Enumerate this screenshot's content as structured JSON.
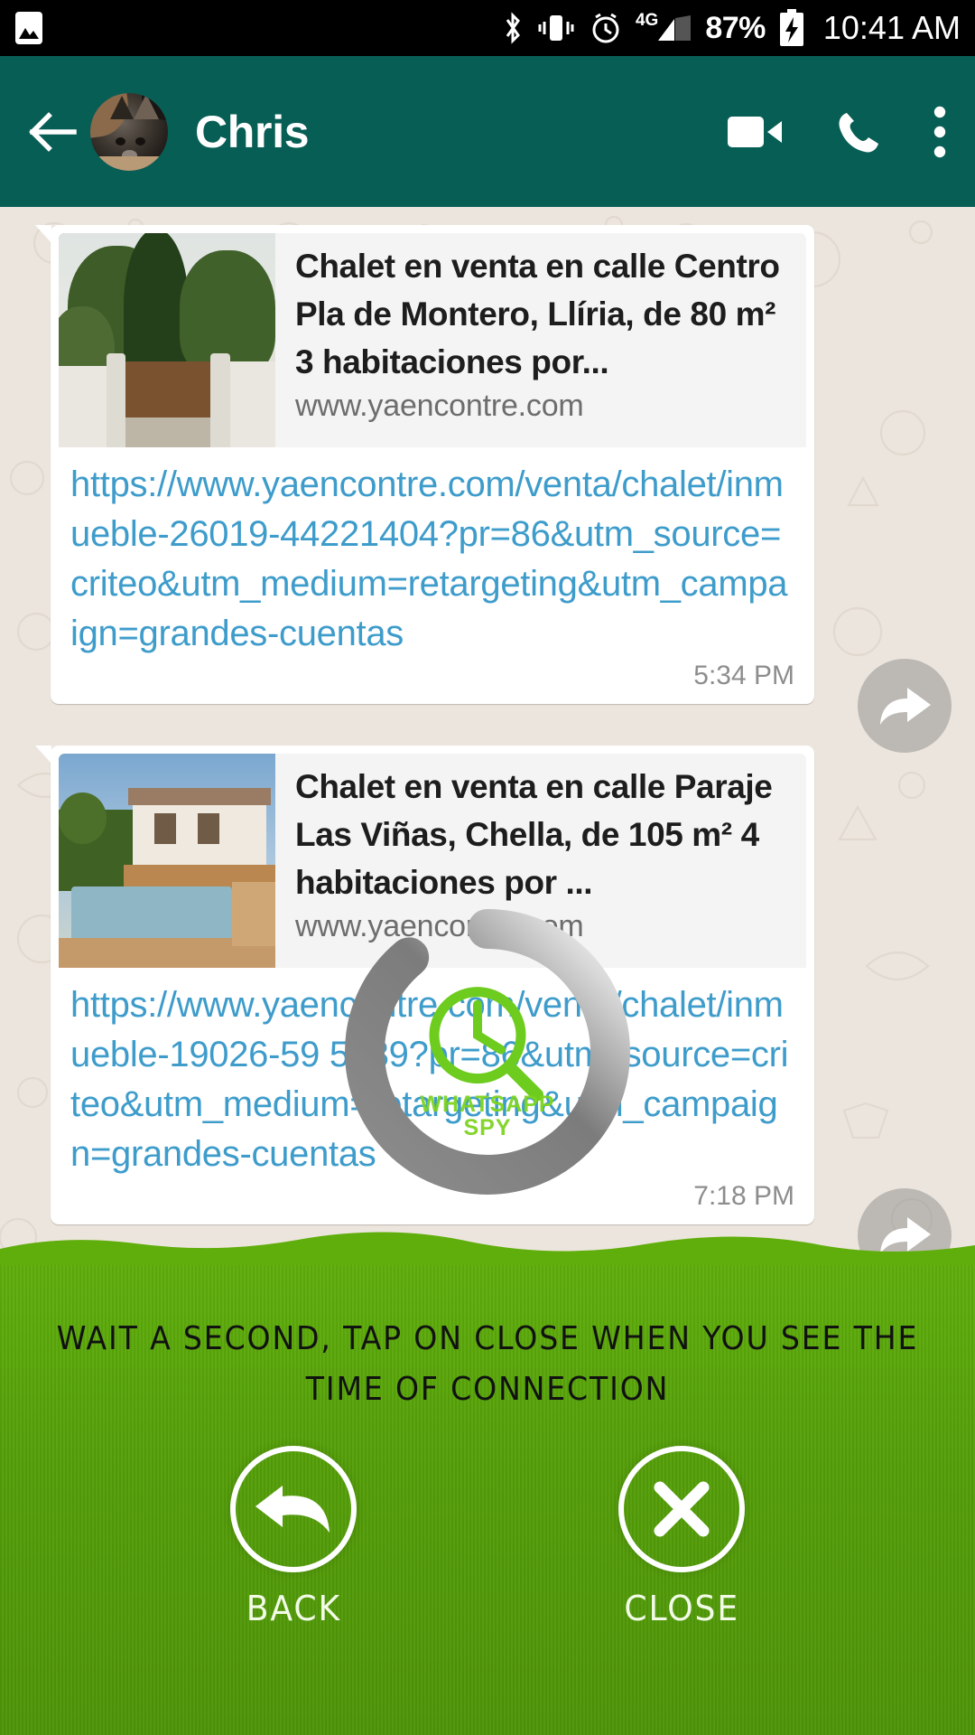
{
  "status_bar": {
    "left_icons": [
      "image-icon"
    ],
    "right_icons": [
      "bluetooth-icon",
      "vibrate-icon",
      "alarm-icon",
      "signal-icon",
      "battery-charging-icon"
    ],
    "network": "4G",
    "battery_percent": "87%",
    "time": "10:41 AM"
  },
  "header": {
    "back_icon": "back-arrow-icon",
    "contact_name": "Chris",
    "avatar": "contact-avatar-cat",
    "actions": [
      "video-call-icon",
      "voice-call-icon",
      "overflow-menu-icon"
    ],
    "background_color": "#075E55"
  },
  "chat": {
    "background_color": "#ECE5DD",
    "messages": [
      {
        "preview_title": "Chalet en venta en calle Centro Pla de Montero, Llíria, de 80 m² 3 habitaciones por...",
        "preview_domain": "www.yaencontre.com",
        "thumbnail": "property-photo-gate-trees",
        "url": "https://www.yaencontre.com/venta/chalet/inmueble-26019-44221404?pr=86&utm_source=criteo&utm_medium=retargeting&utm_campaign=grandes-cuentas",
        "time": "5:34 PM",
        "forward_icon": "forward-arrow-icon"
      },
      {
        "preview_title": "Chalet en venta en calle Paraje Las Viñas, Chella, de 105 m² 4 habitaciones por ...",
        "preview_domain": "www.yaencontre.com",
        "thumbnail": "property-photo-house-pool",
        "url": "https://www.yaencontre.com/venta/chalet/inmueble-19026-59 5839?pr=86&utm_source=criteo&utm_medium=retargeting&utm_campaign=grandes-cuentas",
        "time": "7:18 PM",
        "forward_icon": "forward-arrow-icon"
      }
    ]
  },
  "overlay": {
    "spinner": "loading-spinner",
    "logo_icon": "clock-magnifier-icon",
    "logo_line1": "WHATSAPP",
    "logo_line2": "SPY",
    "logo_color": "#7ED321"
  },
  "bottom_panel": {
    "background_color": "#55A009",
    "instruction_line1": "WAIT A SECOND, TAP ON CLOSE WHEN YOU SEE THE",
    "instruction_line2": "TIME OF CONNECTION",
    "buttons": [
      {
        "label": "BACK",
        "icon": "back-curved-arrow-icon"
      },
      {
        "label": "CLOSE",
        "icon": "close-x-icon"
      }
    ]
  }
}
